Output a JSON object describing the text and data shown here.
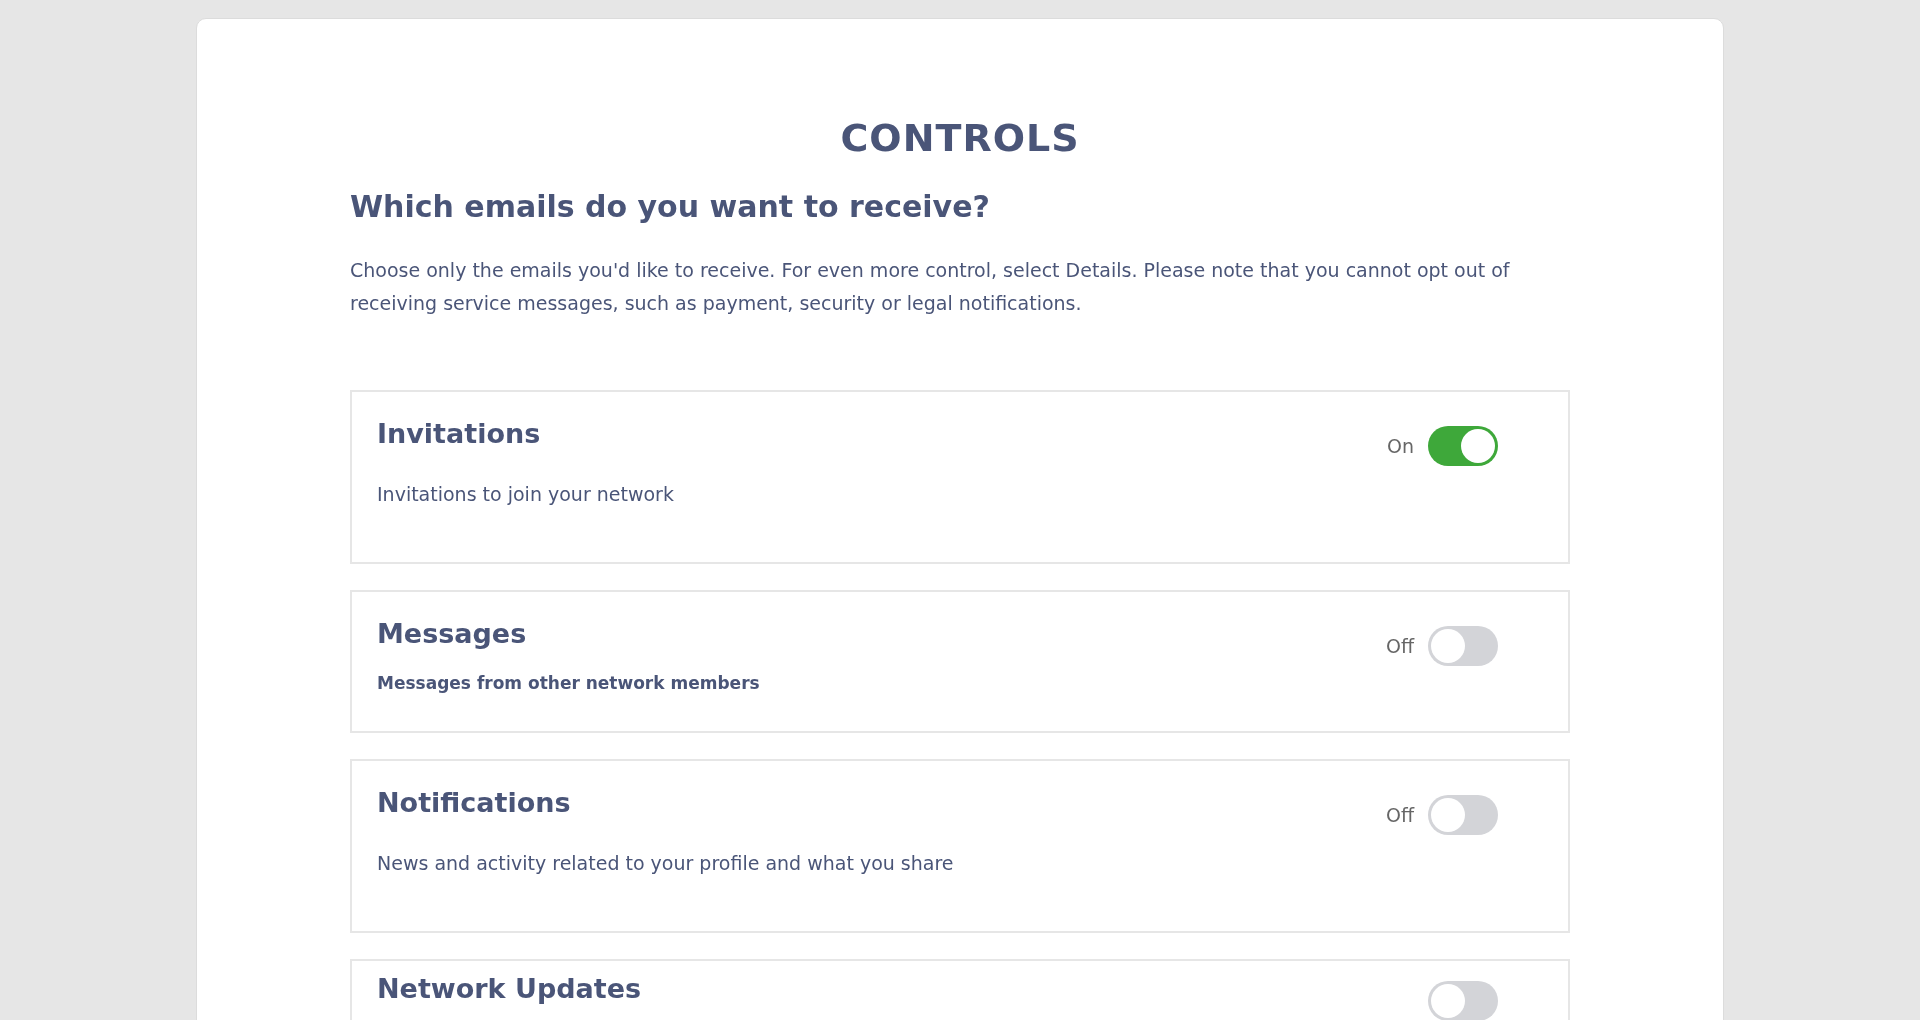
{
  "title": "CONTROLS",
  "heading": "Which emails do you want to receive?",
  "intro": "Choose only the emails you'd like to receive. For even more control, select Details. Please note that you cannot opt out of receiving service messages, such as payment, security or legal notifications.",
  "settings": [
    {
      "title": "Invitations",
      "description": "Invitations to join your network",
      "description_bold": false,
      "state_label": "On",
      "on": true
    },
    {
      "title": "Messages",
      "description": "Messages from other network members",
      "description_bold": true,
      "state_label": "Off",
      "on": false
    },
    {
      "title": "Notifications",
      "description": "News and activity related to your profile and what you share",
      "description_bold": false,
      "state_label": "Off",
      "on": false
    },
    {
      "title": "Network Updates",
      "on": false
    }
  ]
}
